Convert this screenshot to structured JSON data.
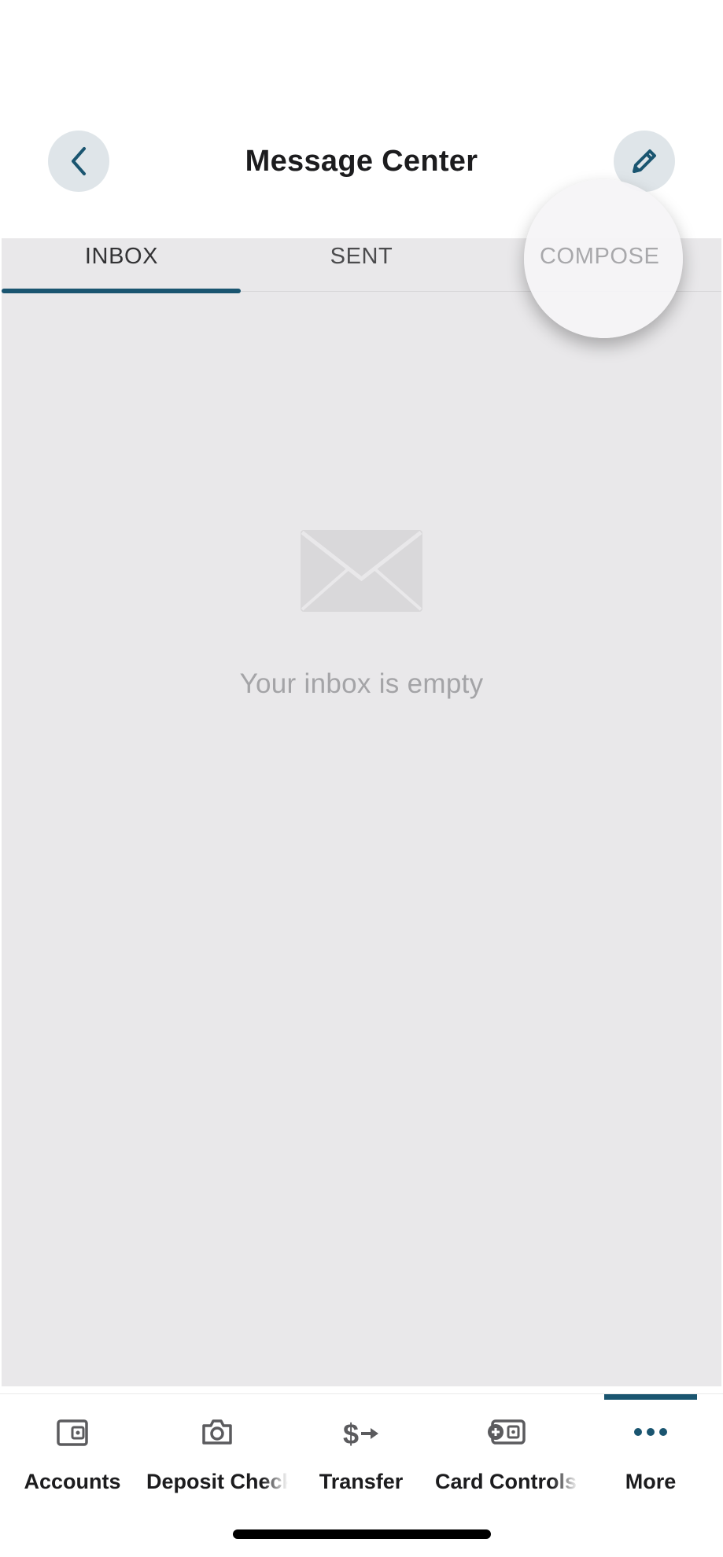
{
  "header": {
    "title": "Message Center",
    "back_icon": "chevron-left-icon",
    "compose_icon": "pencil-icon"
  },
  "tabs": [
    {
      "label": "INBOX",
      "active": true
    },
    {
      "label": "SENT",
      "active": false
    },
    {
      "label": "COMPOSE",
      "active": false
    }
  ],
  "inbox": {
    "empty_icon": "envelope-icon",
    "empty_message": "Your inbox is empty"
  },
  "bottom_nav": {
    "items": [
      {
        "label": "Accounts",
        "icon": "wallet-icon"
      },
      {
        "label": "Deposit Check",
        "icon": "camera-icon"
      },
      {
        "label": "Transfer",
        "icon": "dollar-transfer-icon"
      },
      {
        "label": "Card Controls",
        "icon": "card-controls-icon"
      },
      {
        "label": "More",
        "icon": "more-dots-icon",
        "active": true
      }
    ]
  },
  "colors": {
    "accent": "#1a5570",
    "content_bg": "#e9e8ea",
    "icon_circle_bg": "#dfe5e9",
    "muted_text": "#a4a4a7"
  }
}
